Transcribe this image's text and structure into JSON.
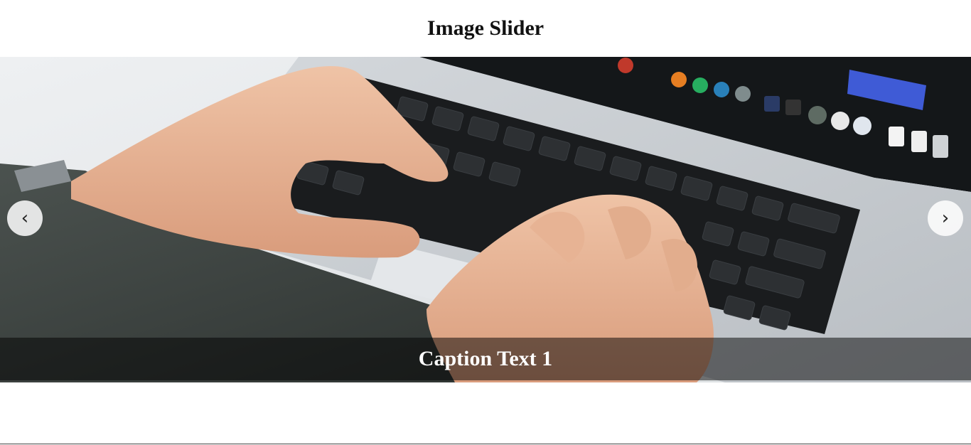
{
  "header": {
    "title": "Image Slider"
  },
  "slider": {
    "current_slide": 1,
    "caption": "Caption Text 1",
    "prev_icon": "‹",
    "next_icon": "›",
    "image_subject": "hands typing on laptop keyboard",
    "colors": {
      "caption_overlay": "#000000",
      "nav_button": "#ffffff"
    }
  }
}
